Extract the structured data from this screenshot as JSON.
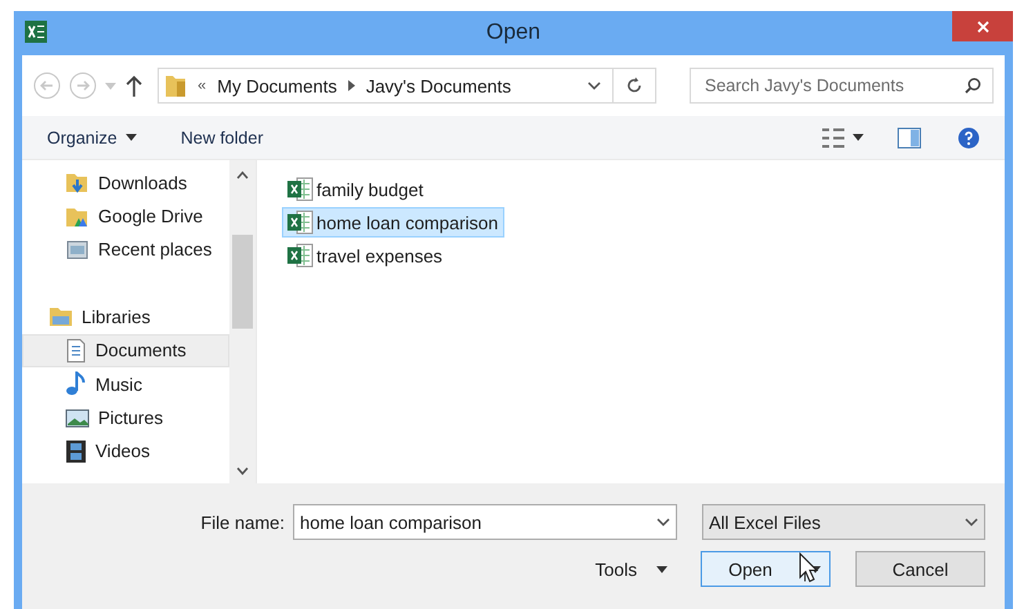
{
  "window": {
    "title": "Open"
  },
  "address": {
    "overflow": "«",
    "crumbs": [
      "My Documents",
      "Javy's Documents"
    ]
  },
  "search": {
    "placeholder": "Search Javy's Documents"
  },
  "toolbar": {
    "organize": "Organize",
    "new_folder": "New folder"
  },
  "sidebar": {
    "groups": [
      {
        "children": [
          {
            "label": "Downloads",
            "kind": "downloads",
            "selected": false
          },
          {
            "label": "Google Drive",
            "kind": "drive",
            "selected": false
          },
          {
            "label": "Recent places",
            "kind": "recent",
            "selected": false
          }
        ]
      },
      {
        "label": "Libraries",
        "kind": "library",
        "children": [
          {
            "label": "Documents",
            "kind": "documents",
            "selected": true
          },
          {
            "label": "Music",
            "kind": "music",
            "selected": false
          },
          {
            "label": "Pictures",
            "kind": "pictures",
            "selected": false
          },
          {
            "label": "Videos",
            "kind": "videos",
            "selected": false
          }
        ]
      }
    ]
  },
  "files": [
    {
      "name": "family budget",
      "selected": false
    },
    {
      "name": "home loan comparison",
      "selected": true
    },
    {
      "name": "travel expenses",
      "selected": false
    }
  ],
  "file_name": {
    "label": "File name:",
    "value": "home loan comparison"
  },
  "file_type": {
    "value": "All Excel Files"
  },
  "buttons": {
    "tools": "Tools",
    "open": "Open",
    "cancel": "Cancel"
  }
}
